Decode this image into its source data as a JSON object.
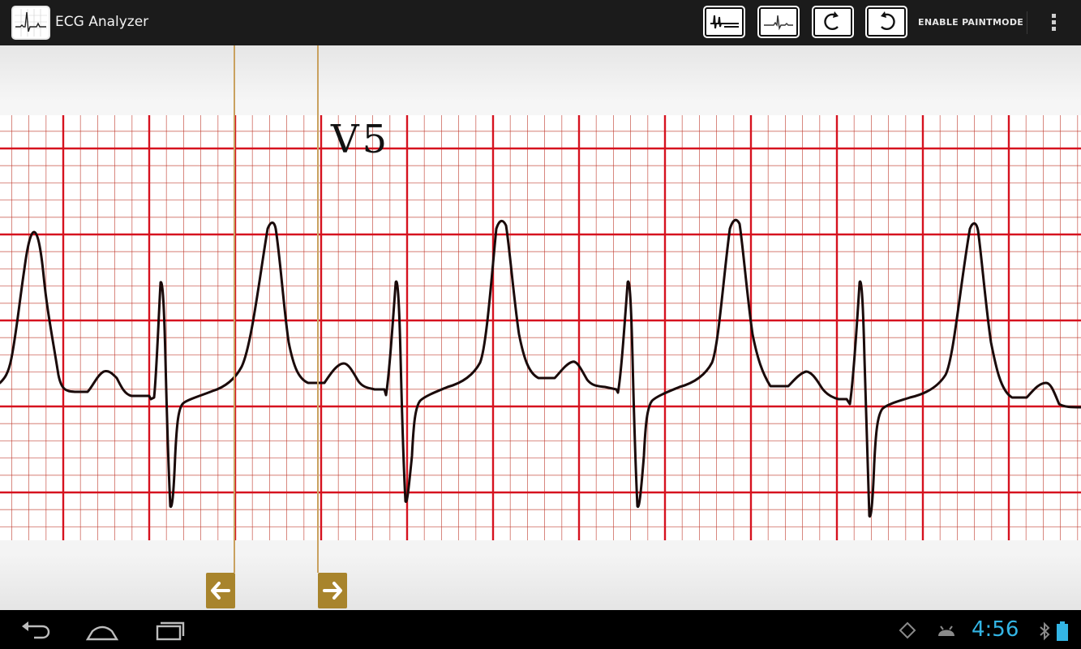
{
  "app": {
    "title": "ECG Analyzer"
  },
  "toolbar": {
    "tools": [
      {
        "name": "caliper-tool",
        "icon": "caliper-icon"
      },
      {
        "name": "ecg-wave-tool",
        "icon": "ecg-wave-icon"
      },
      {
        "name": "rotate-left-tool",
        "icon": "rotate-left-icon"
      },
      {
        "name": "rotate-right-tool",
        "icon": "rotate-right-icon"
      }
    ],
    "paint_label": "ENABLE PAINTMODE",
    "overflow_icon": "overflow-menu-icon"
  },
  "ecg": {
    "lead_label": "V5",
    "grid_minor_color": "#c0392b",
    "grid_major_color": "#d6121f",
    "trace_color": "#1a0a0a"
  },
  "calipers": {
    "left_icon": "arrow-left-icon",
    "right_icon": "arrow-right-icon",
    "color": "#a8842c"
  },
  "statusbar": {
    "time": "4:56",
    "accent": "#33b5e5"
  }
}
